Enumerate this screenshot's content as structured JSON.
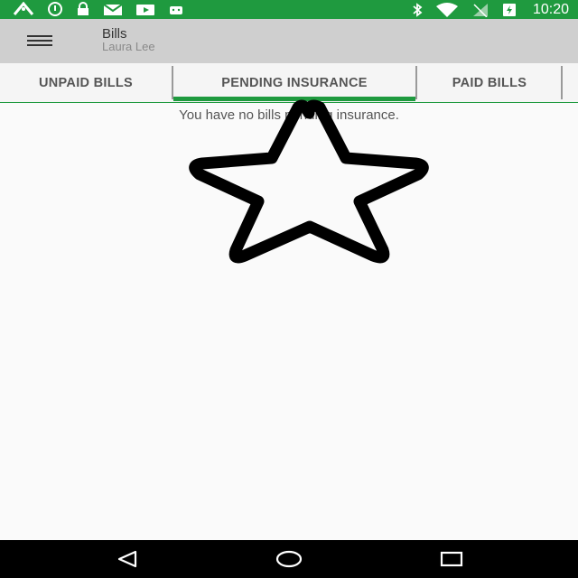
{
  "status_bar": {
    "time": "10:20",
    "left_icons": [
      "signal-antenna-icon",
      "info-icon",
      "lock-icon",
      "mail-icon",
      "play-icon",
      "android-icon"
    ],
    "right_icons": [
      "bluetooth-icon",
      "wifi-icon",
      "no-sim-icon",
      "battery-charging-icon"
    ]
  },
  "app_bar": {
    "title": "Bills",
    "subtitle": "Laura Lee"
  },
  "tabs": [
    {
      "label": "UNPAID BILLS",
      "selected": false
    },
    {
      "label": "PENDING INSURANCE",
      "selected": true
    },
    {
      "label": "PAID BILLS",
      "selected": false
    }
  ],
  "content": {
    "empty_message": "You have no bills pending insurance."
  },
  "nav_bar": {
    "buttons": [
      "back-icon",
      "home-icon",
      "recents-icon"
    ]
  },
  "colors": {
    "accent": "#1f9a3f",
    "app_bar_bg": "#cfcfcf",
    "nav_bg": "#000000"
  }
}
